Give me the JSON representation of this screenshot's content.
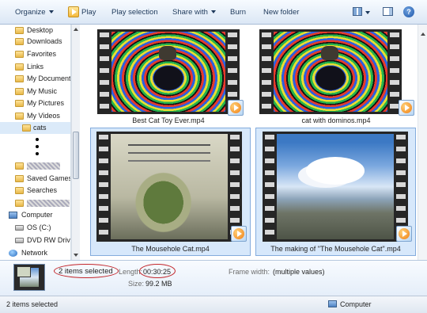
{
  "toolbar": {
    "organize": "Organize",
    "play": "Play",
    "play_selection": "Play selection",
    "share_with": "Share with",
    "burn": "Burn",
    "new_folder": "New folder",
    "help": "?"
  },
  "sidebar": {
    "items": [
      {
        "label": "Desktop"
      },
      {
        "label": "Downloads"
      },
      {
        "label": "Favorites"
      },
      {
        "label": "Links"
      },
      {
        "label": "My Documents"
      },
      {
        "label": "My Music"
      },
      {
        "label": "My Pictures"
      },
      {
        "label": "My Videos"
      },
      {
        "label": "cats"
      },
      {
        "label": "Saved Games"
      },
      {
        "label": "Searches"
      },
      {
        "label": "Computer"
      },
      {
        "label": "OS (C:)"
      },
      {
        "label": "DVD RW Drive"
      },
      {
        "label": "Network"
      }
    ]
  },
  "files": [
    {
      "name": "Best Cat Toy Ever.mp4",
      "selected": false
    },
    {
      "name": "cat with dominos.mp4",
      "selected": false
    },
    {
      "name": "The Mousehole Cat.mp4",
      "selected": true
    },
    {
      "name": "The making of \"The Mousehole Cat\".mp4",
      "selected": true
    }
  ],
  "details": {
    "count": "2 items selected",
    "length_label": "Length:",
    "length_value": "00:30:25",
    "size_label": "Size:",
    "size_value": "99.2 MB",
    "frame_width_label": "Frame width:",
    "frame_width_value": "(multiple values)"
  },
  "status": {
    "selected": "2 items selected",
    "location": "Computer"
  },
  "colors": {
    "highlight_ellipse": "#c3262b",
    "selection_fill": "#d7e8fb"
  }
}
